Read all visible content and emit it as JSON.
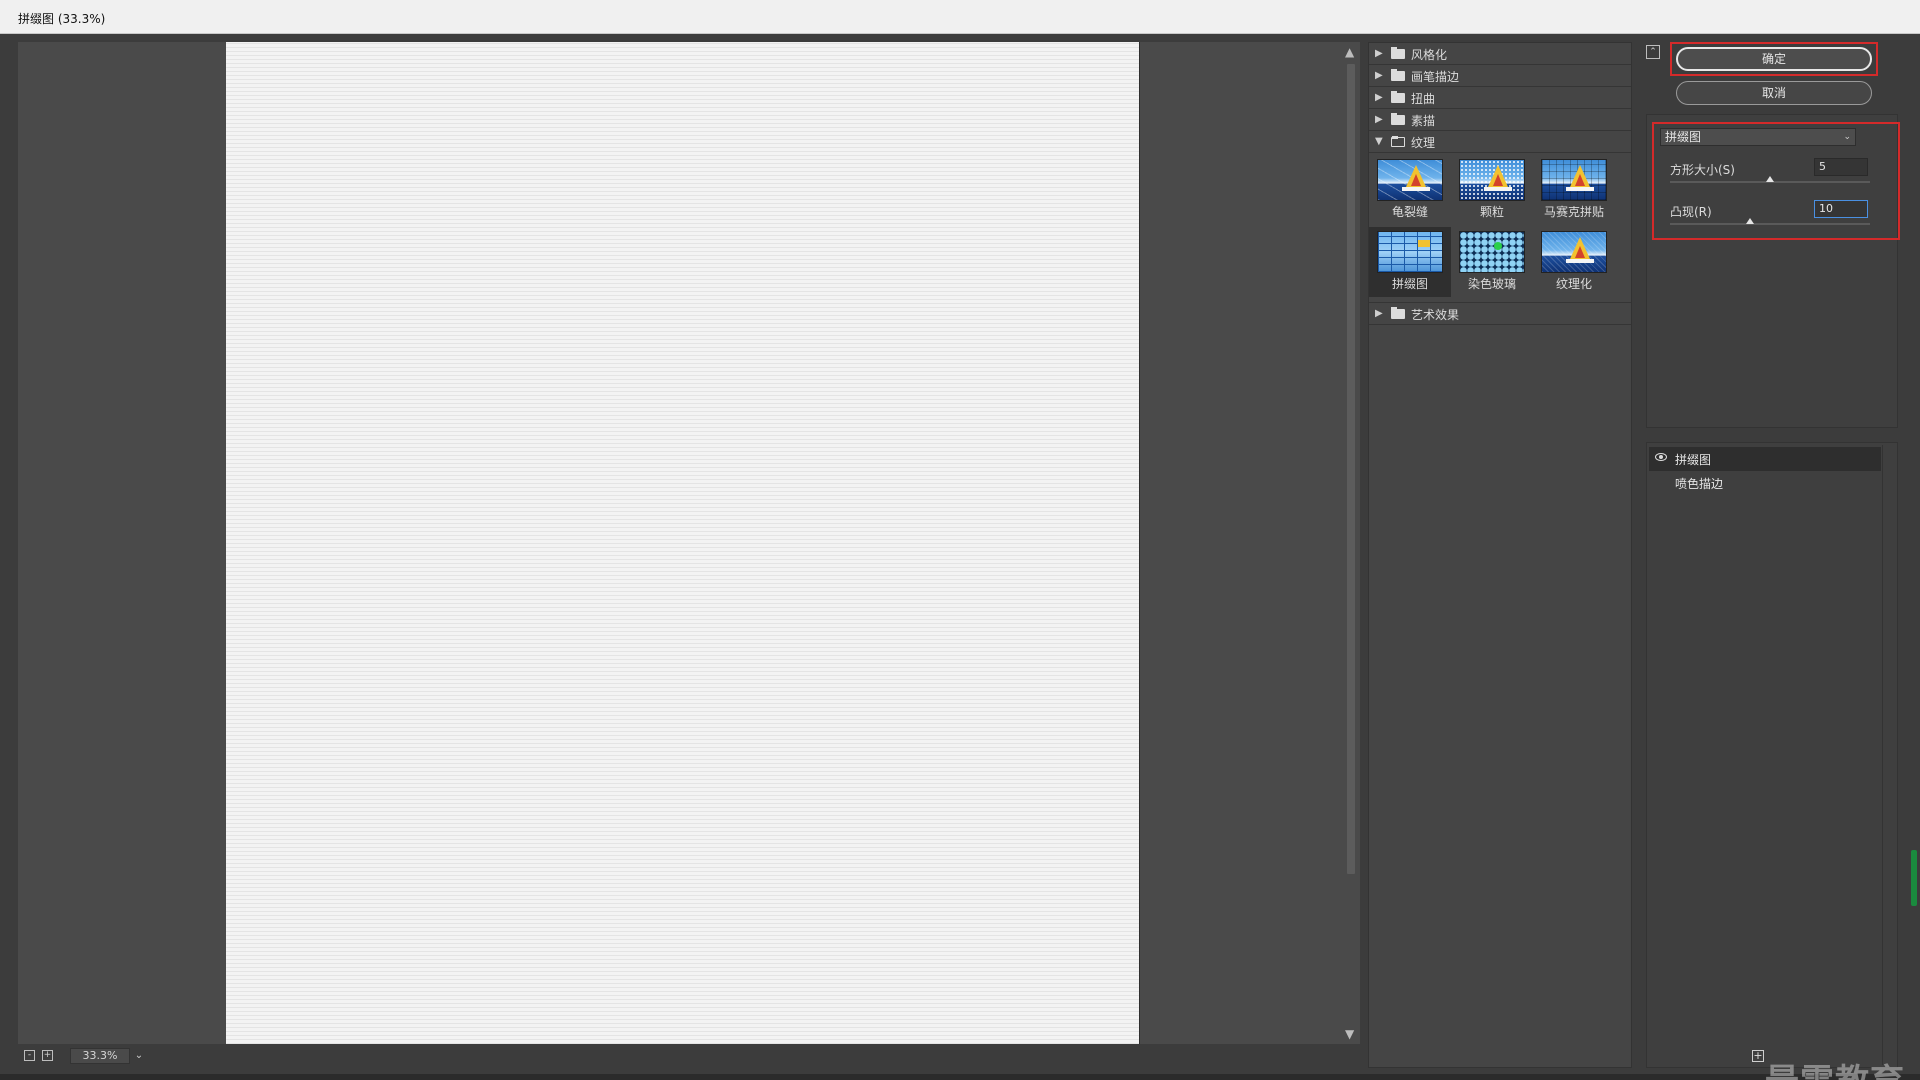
{
  "window": {
    "title": "拼缀图 (33.3%)"
  },
  "preview": {
    "zoom": "33.3%",
    "zoom_minus": "-",
    "zoom_plus": "+"
  },
  "gallery": {
    "folders_top": [
      {
        "label": "风格化"
      },
      {
        "label": "画笔描边"
      },
      {
        "label": "扭曲"
      },
      {
        "label": "素描"
      }
    ],
    "open_folder": {
      "label": "纹理"
    },
    "filters": [
      {
        "label": "龟裂缝"
      },
      {
        "label": "颗粒"
      },
      {
        "label": "马赛克拼贴"
      },
      {
        "label": "拼缀图"
      },
      {
        "label": "染色玻璃"
      },
      {
        "label": "纹理化"
      }
    ],
    "folders_bottom": [
      {
        "label": "艺术效果"
      }
    ]
  },
  "dialog": {
    "ok_label": "确定",
    "cancel_label": "取消",
    "filter_select": "拼缀图",
    "params": [
      {
        "label": "方形大小(S)",
        "value": "5",
        "level": 0.5
      },
      {
        "label": "凸现(R)",
        "value": "10",
        "level": 0.4
      }
    ]
  },
  "layers": [
    {
      "name": "拼缀图",
      "active": true
    },
    {
      "name": "喷色描边",
      "active": false
    }
  ],
  "watermark": "最需教育",
  "colors": {
    "highlight": "#d42a2a",
    "selected_bg": "#2f2f2f",
    "active_input": "#4a90e2"
  }
}
